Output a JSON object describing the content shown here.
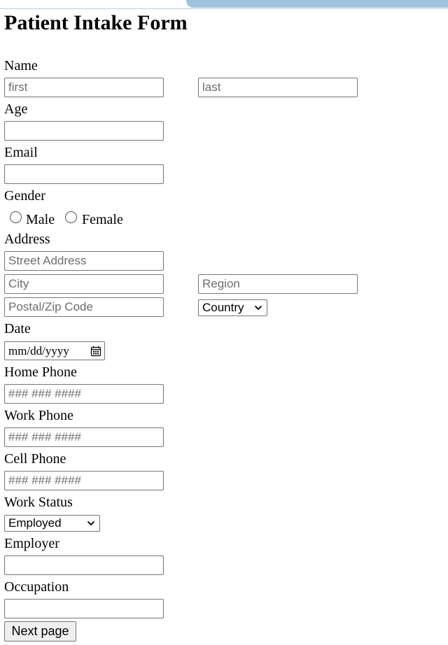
{
  "form": {
    "title": "Patient Intake Form",
    "name": {
      "label": "Name",
      "first_placeholder": "first",
      "last_placeholder": "last"
    },
    "age": {
      "label": "Age",
      "value": ""
    },
    "email": {
      "label": "Email",
      "value": ""
    },
    "gender": {
      "label": "Gender",
      "options": [
        "Male",
        "Female"
      ],
      "selected": null
    },
    "address": {
      "label": "Address",
      "street_placeholder": "Street Address",
      "city_placeholder": "City",
      "region_placeholder": "Region",
      "postal_placeholder": "Postal/Zip Code",
      "country_selected": "Country"
    },
    "date": {
      "label": "Date",
      "placeholder": "mm/dd/yyyy"
    },
    "home_phone": {
      "label": "Home Phone",
      "placeholder": "### ### ####"
    },
    "work_phone": {
      "label": "Work Phone",
      "placeholder": "### ### ####"
    },
    "cell_phone": {
      "label": "Cell Phone",
      "placeholder": "### ### ####"
    },
    "work_status": {
      "label": "Work Status",
      "selected": "Employed"
    },
    "employer": {
      "label": "Employer",
      "value": ""
    },
    "occupation": {
      "label": "Occupation",
      "value": ""
    },
    "next_button": "Next page"
  },
  "icons": {
    "calendar": "calendar-icon",
    "chevron": "chevron-down-icon"
  }
}
